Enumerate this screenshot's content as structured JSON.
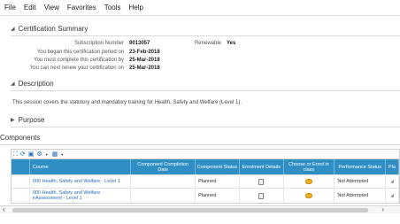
{
  "menu": [
    "File",
    "Edit",
    "View",
    "Favorites",
    "Tools",
    "Help"
  ],
  "certification_summary": {
    "title": "Certification Summary",
    "subscription_number_label": "Subscription Number",
    "subscription_number": "9013057",
    "renewable_label": "Renewable",
    "renewable": "Yes",
    "began_label": "You began this certification period on",
    "began": "23-Feb-2018",
    "complete_label": "You must complete this certification by",
    "complete": "25-Mar-2018",
    "renew_label": "You can next renew your certification on",
    "renew": "25-Mar-2018"
  },
  "description": {
    "title": "Description",
    "text": "This session covers the statutory and mandatory training for Health, Safety and Welfare (Level 1)."
  },
  "purpose": {
    "title": "Purpose"
  },
  "components": {
    "title": "Components",
    "columns": [
      "",
      "Course",
      "Component Completion Date",
      "Component Status",
      "Enrolment Details",
      "Choose or Enrol in class",
      "Performance Status",
      "Pla"
    ],
    "rows": [
      {
        "course": "000 Health, Safety and Welfare - Level 1",
        "completion_date": "",
        "status": "Planned",
        "performance": "Not Attempted"
      },
      {
        "course": "000 Health, Safety and Welfare eAssessment - Level 1",
        "completion_date": "",
        "status": "Planned",
        "performance": "Not Attempted"
      }
    ]
  },
  "icons": {
    "toolbar": [
      "expand-icon",
      "refresh-icon",
      "export-icon",
      "settings-icon",
      "view-icon"
    ],
    "enrolment": "document-icon",
    "enrol": "enrol-icon"
  },
  "colors": {
    "header_blue": "#2f8fc4",
    "link_blue": "#2a6ebb"
  }
}
